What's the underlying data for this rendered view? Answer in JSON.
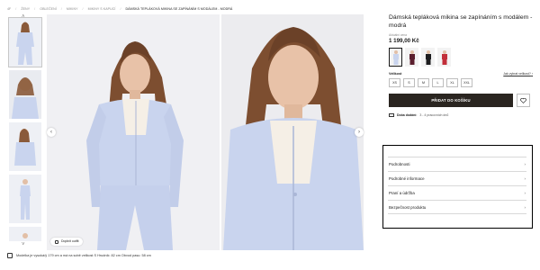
{
  "breadcrumb": [
    "4F",
    "ŽENY",
    "OBLEČENÍ",
    "MIKINY",
    "MIKINY S KAPUCÍ",
    "DÁMSKÁ TEPLÁKOVÁ MIKINA SE ZAPÍNÁNÍM S MODÁLEM - MODRÁ"
  ],
  "gallery": {
    "outfit_label": "Doplnit outfit",
    "prev_icon": "‹",
    "next_icon": "›",
    "thumb_up_icon": "˄",
    "thumb_down_icon": "˅"
  },
  "model_info": "Modelka je vysoká/ý 179 cm a má na sobě velikost S   Hrudník: 82 cm   Obvod pasu: 58 cm",
  "product": {
    "title": "Dámská tepláková mikina se zapínáním s modálem - modrá",
    "price_label": "Aktuální cena",
    "price": "1 199,00 Kč",
    "colors": [
      {
        "name": "light-blue",
        "hex": "#c9d4ee"
      },
      {
        "name": "burgundy",
        "hex": "#5b1f2e"
      },
      {
        "name": "black",
        "hex": "#1d1d1f"
      },
      {
        "name": "red",
        "hex": "#c22f3a"
      }
    ],
    "size_label": "Velikost",
    "size_guide": "Jak vybrat velikost?",
    "sizes": [
      "XS",
      "S",
      "M",
      "L",
      "XL",
      "XXL"
    ],
    "add_to_cart": "PŘIDAT DO KOŠÍKU",
    "delivery_label": "Doba dodání:",
    "delivery_value": "3 - 4 pracovních dnů"
  },
  "accordion": [
    "Podrobnosti",
    "Podrobné informace",
    "Praní a údržba",
    "Bezpečnost produktu"
  ],
  "icons": {
    "chevron": "›",
    "heart": "heart-icon",
    "truck": "truck-icon",
    "hanger": "hanger-icon",
    "ruler": "ruler-icon"
  },
  "colors": {
    "accent": "#2a2520",
    "highlight_border": "#000000",
    "product_blue": "#c9d4ee"
  }
}
